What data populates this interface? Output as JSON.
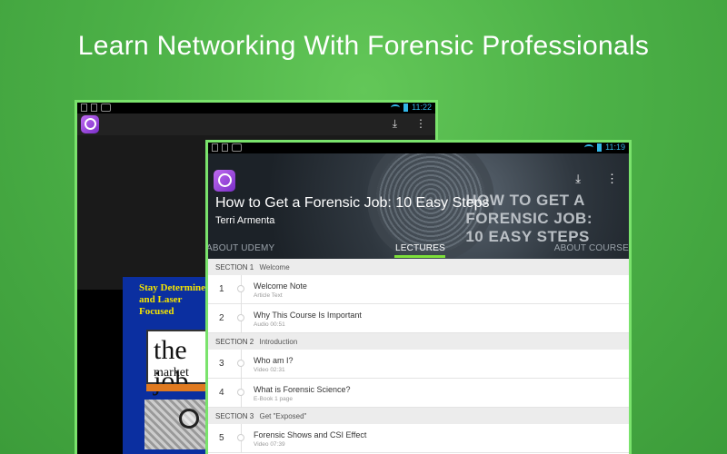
{
  "headline": "Learn Networking With Forensic Professionals",
  "back_device": {
    "status_time": "11:22",
    "slide_title": "Stay Determined\nand Laser\nFocused",
    "slide_image_text_top": "the job",
    "slide_image_text_bottom": "market"
  },
  "front_device": {
    "status_time": "11:19",
    "hero_overlay_text": "HOW TO GET A\nFORENSIC JOB:\n10 EASY STEPS",
    "course_title": "How to Get a Forensic Job: 10 Easy Steps",
    "course_author": "Terri  Armenta",
    "tabs": {
      "left": "ABOUT UDEMY",
      "center": "LECTURES",
      "right": "ABOUT COURSE"
    },
    "sections": [
      {
        "num": "SECTION 1",
        "name": "Welcome",
        "lectures": [
          {
            "num": "1",
            "title": "Welcome Note",
            "meta": "Article Text"
          },
          {
            "num": "2",
            "title": "Why This Course Is Important",
            "meta": "Audio 00:51"
          }
        ]
      },
      {
        "num": "SECTION 2",
        "name": "Introduction",
        "lectures": [
          {
            "num": "3",
            "title": "Who am I?",
            "meta": "Video 02:31"
          },
          {
            "num": "4",
            "title": "What is Forensic Science?",
            "meta": "E-Book 1 page"
          }
        ]
      },
      {
        "num": "SECTION 3",
        "name": "Get \"Exposed\"",
        "lectures": [
          {
            "num": "5",
            "title": "Forensic Shows and CSI Effect",
            "meta": "Video 07:39"
          }
        ]
      }
    ]
  },
  "colors": {
    "background": "#4cb147",
    "device_border": "#7ae36c",
    "tab_underline": "#7ee03a",
    "status_icons": "#33b5e5"
  }
}
